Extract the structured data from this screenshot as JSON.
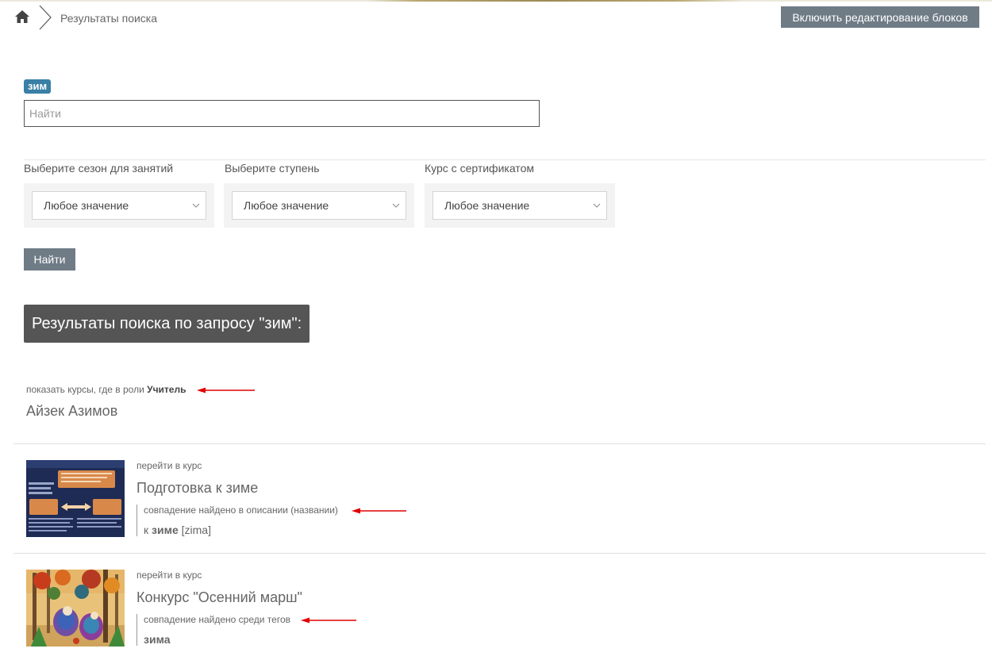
{
  "breadcrumb": {
    "current": "Результаты поиска"
  },
  "header": {
    "edit_button": "Включить редактирование блоков"
  },
  "search": {
    "tag": "зим",
    "placeholder": "Найти"
  },
  "filters": [
    {
      "label": "Выберите сезон для занятий",
      "value": "Любое значение"
    },
    {
      "label": "Выберите ступень",
      "value": "Любое значение"
    },
    {
      "label": "Курс с сертификатом",
      "value": "Любое значение"
    }
  ],
  "find_button": "Найти",
  "results": {
    "heading": "Результаты поиска по запросу \"зим\":",
    "role_prefix": "показать курсы, где в роли ",
    "role_name": "Учитель",
    "teacher": "Айзек Азимов"
  },
  "courses": [
    {
      "go_label": "перейти в курс",
      "title": "Подготовка к зиме",
      "match": "совпадение найдено в описании (названии)",
      "word_prefix": "к ",
      "word_bold": "зиме",
      "word_suffix": " [zima]"
    },
    {
      "go_label": "перейти в курс",
      "title": "Конкурс \"Осенний марш\"",
      "match": "совпадение найдено среди тегов",
      "word_prefix": "",
      "word_bold": "зима",
      "word_suffix": ""
    }
  ],
  "colors": {
    "button": "#6f7b85",
    "tag": "#3a7fa6",
    "heading_bg": "#555555",
    "arrow": "#e00000"
  }
}
